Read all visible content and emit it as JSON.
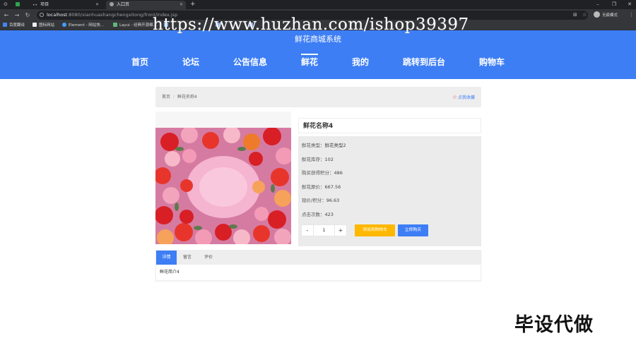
{
  "browser": {
    "tabs": [
      {
        "title": "",
        "active": false
      },
      {
        "title": "项目",
        "active": false
      },
      {
        "title": "入口页",
        "active": true
      }
    ],
    "url_host": "localhost",
    "url_path": ":8080/xianhuashangchengxitong/front/index.jsp",
    "profile_label": "无痕模式",
    "bookmarks": [
      "百度翻译",
      "图标网站",
      "Element - 网站快...",
      "Layui - 经典开源模...",
      "",
      "",
      ""
    ]
  },
  "watermark": "https://www.huzhan.com/ishop39397",
  "site": {
    "title": "鲜花商城系统",
    "nav": [
      "首页",
      "论坛",
      "公告信息",
      "鲜花",
      "我的",
      "跳转到后台",
      "购物车"
    ],
    "active_nav_index": 3,
    "accent_color": "#3d7ef5"
  },
  "breadcrumb": {
    "home": "首页",
    "separator": "/",
    "current": "鲜花名称4",
    "favorite_label": "点我收藏"
  },
  "product": {
    "name": "鲜花名称4",
    "fields": [
      {
        "label": "鲜花类型：",
        "value": "鲜花类型2"
      },
      {
        "label": "鲜花库存：",
        "value": "102"
      },
      {
        "label": "购买获得积分：",
        "value": "486"
      },
      {
        "label": "鲜花原价：",
        "value": "667.56"
      },
      {
        "label": "现价/积分：",
        "value": "96.63"
      },
      {
        "label": "点击次数：",
        "value": "423"
      }
    ],
    "quantity": "1",
    "minus": "-",
    "plus": "+",
    "add_to_cart": "添加到购物车",
    "buy_now": "立即购买"
  },
  "detail_tabs": {
    "tabs": [
      "详情",
      "留言",
      "评价"
    ],
    "active_index": 0,
    "content": "鲜花简介4"
  },
  "corner_watermark": "毕设代做"
}
